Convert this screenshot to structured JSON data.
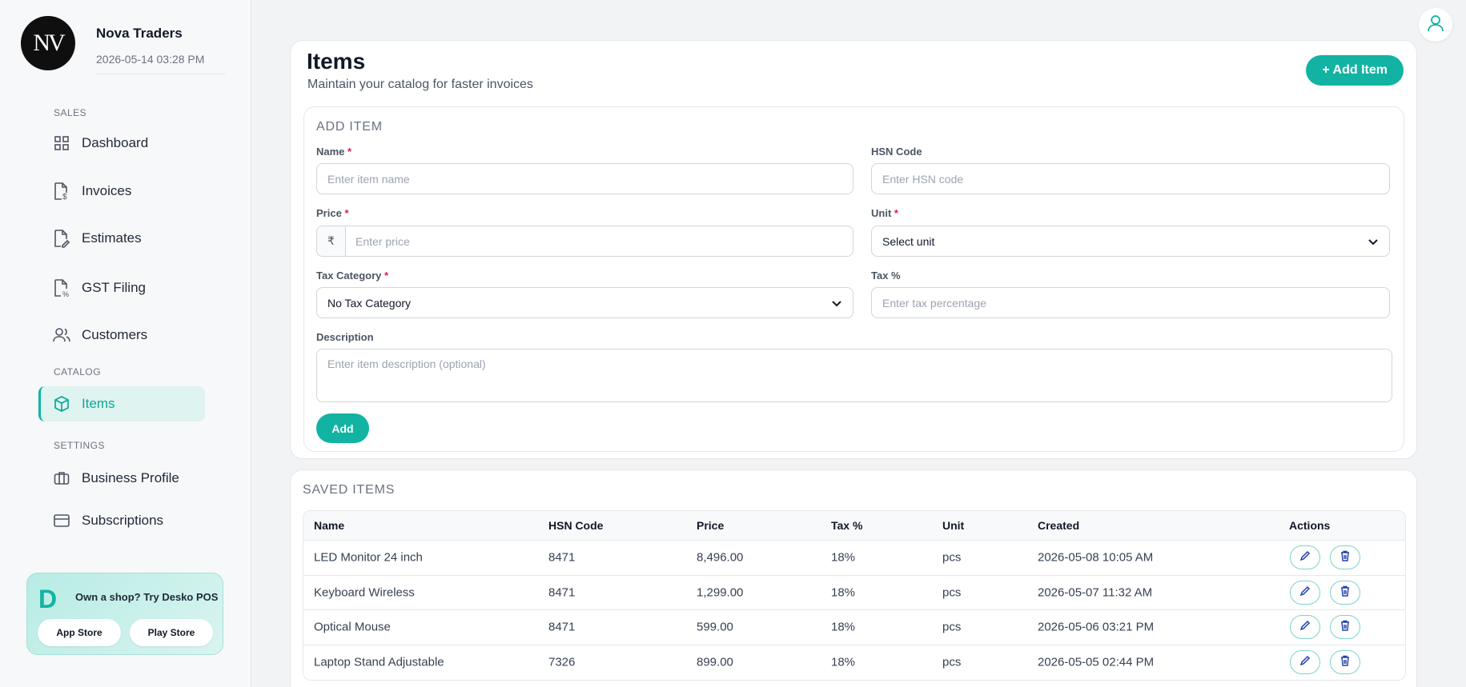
{
  "brand": {
    "name": "Nova Traders",
    "timestamp": "2026-05-14 03:28 PM",
    "logo_text": "NV"
  },
  "sidebar": {
    "sections": [
      {
        "label": "SALES"
      },
      {
        "label": "CATALOG"
      },
      {
        "label": "SETTINGS"
      }
    ],
    "items": [
      {
        "label": "Dashboard",
        "icon": "grid-icon"
      },
      {
        "label": "Invoices",
        "icon": "invoice-icon"
      },
      {
        "label": "Estimates",
        "icon": "estimate-icon"
      },
      {
        "label": "GST Filing",
        "icon": "gst-icon"
      },
      {
        "label": "Customers",
        "icon": "users-icon"
      },
      {
        "label": "Items",
        "icon": "box-icon",
        "active": true
      },
      {
        "label": "Business Profile",
        "icon": "briefcase-icon"
      },
      {
        "label": "Subscriptions",
        "icon": "card-icon"
      }
    ]
  },
  "promo": {
    "logo_letter": "D",
    "text": "Own a shop? Try Desko POS",
    "app_store": "App Store",
    "play_store": "Play Store"
  },
  "page": {
    "title": "Items",
    "subtitle": "Maintain your catalog for faster invoices",
    "add_item_button": "+ Add Item"
  },
  "form": {
    "title": "ADD ITEM",
    "name": {
      "label": "Name",
      "required": "*",
      "placeholder": "Enter item name"
    },
    "hsn": {
      "label": "HSN Code",
      "placeholder": "Enter HSN code"
    },
    "price": {
      "label": "Price",
      "required": "*",
      "currency": "₹",
      "placeholder": "Enter price"
    },
    "unit": {
      "label": "Unit",
      "required": "*",
      "value": "Select unit"
    },
    "tax_category": {
      "label": "Tax Category",
      "required": "*",
      "value": "No Tax Category"
    },
    "tax_percent": {
      "label": "Tax %",
      "placeholder": "Enter tax percentage"
    },
    "description": {
      "label": "Description",
      "placeholder": "Enter item description (optional)"
    },
    "submit": "Add"
  },
  "saved": {
    "title": "SAVED ITEMS",
    "columns": [
      "Name",
      "HSN Code",
      "Price",
      "Tax %",
      "Unit",
      "Created",
      "Actions"
    ],
    "rows": [
      {
        "name": "LED Monitor 24 inch",
        "hsn": "8471",
        "price": "8,496.00",
        "tax": "18%",
        "unit": "pcs",
        "created": "2026-05-08 10:05 AM"
      },
      {
        "name": "Keyboard Wireless",
        "hsn": "8471",
        "price": "1,299.00",
        "tax": "18%",
        "unit": "pcs",
        "created": "2026-05-07 11:32 AM"
      },
      {
        "name": "Optical Mouse",
        "hsn": "8471",
        "price": "599.00",
        "tax": "18%",
        "unit": "pcs",
        "created": "2026-05-06 03:21 PM"
      },
      {
        "name": "Laptop Stand Adjustable",
        "hsn": "7326",
        "price": "899.00",
        "tax": "18%",
        "unit": "pcs",
        "created": "2026-05-05 02:44 PM"
      }
    ]
  },
  "colors": {
    "accent": "#12b3a2",
    "active_bg": "#dff3f0",
    "sidebar_bg": "#f7f8f9"
  }
}
